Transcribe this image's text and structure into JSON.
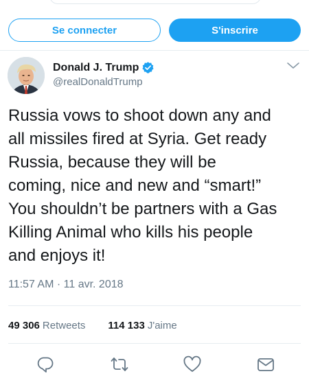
{
  "auth": {
    "login_label": "Se connecter",
    "signup_label": "S'inscrire"
  },
  "tweet": {
    "author_name": "Donald J. Trump",
    "author_handle": "@realDonaldTrump",
    "verified": true,
    "text": "Russia vows to shoot down any and\nall missiles fired at Syria. Get ready\nRussia,  because they will be\ncoming, nice and new and “smart!”\nYou shouldn’t be partners with a Gas\nKilling Animal who kills his people\nand enjoys it!",
    "timestamp": "11:57 AM · 11 avr. 2018",
    "retweets_count": "49 306",
    "retweets_label": "Retweets",
    "likes_count": "114 133",
    "likes_label": "J'aime"
  },
  "actions": [
    "reply-icon",
    "retweet-icon",
    "like-icon",
    "message-icon"
  ],
  "colors": {
    "accent": "#1da1f2",
    "text": "#14171a",
    "muted": "#657786",
    "divider": "#e6ecf0"
  }
}
